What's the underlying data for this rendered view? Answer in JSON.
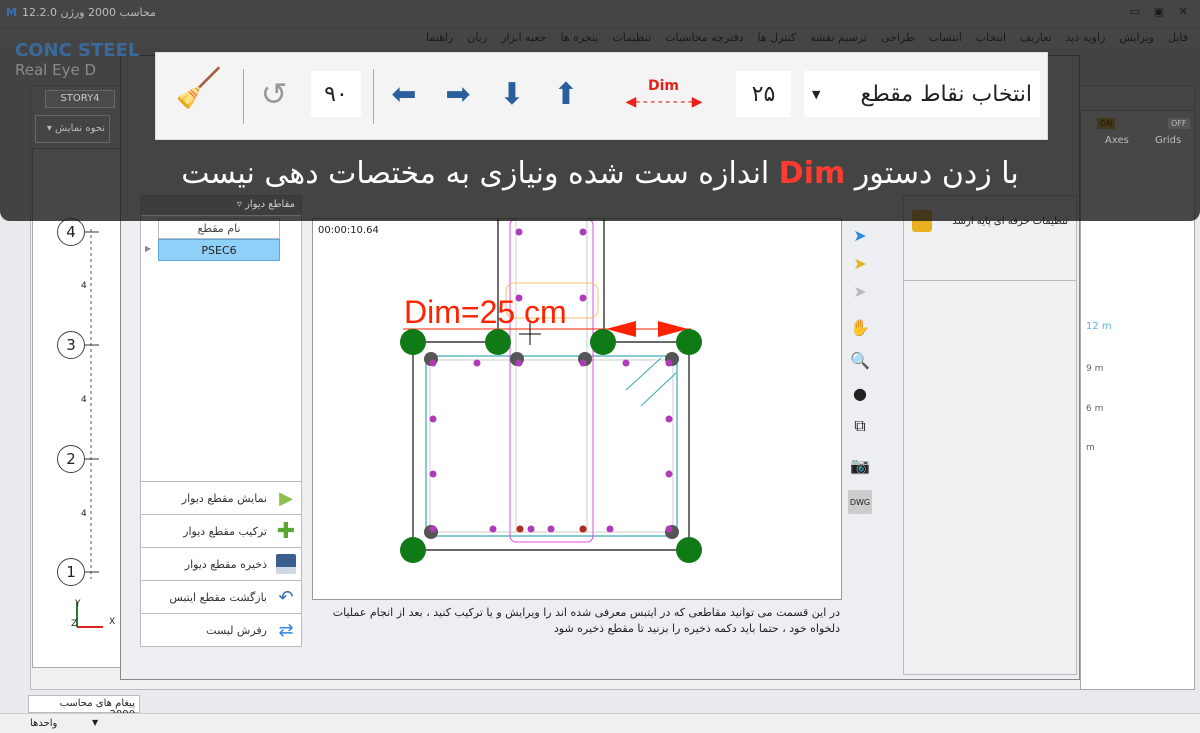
{
  "window": {
    "title": "محاسب 2000 ورژن 12.2.0",
    "app_icon": "M"
  },
  "menu": [
    "فایل",
    "ویرایش",
    "زاویه دید",
    "تعاریف",
    "انتخاب",
    "انتساب",
    "طراحی",
    "ترسیم نقشه",
    "کنترل ها",
    "دفترچه محاسبات",
    "تنظیمات",
    "پنجره ها",
    "جعبه ابزار",
    "زبان",
    "راهنما"
  ],
  "logo": {
    "text": "CONC STEEL",
    "subtitle": "Real Eye D"
  },
  "story_tab": "STORY4",
  "view_mode_dropdown": "نحوه نمایش",
  "plan_axes": [
    {
      "label": "4"
    },
    {
      "label": "3"
    },
    {
      "label": "2"
    },
    {
      "label": "1"
    }
  ],
  "plan_spacings": [
    "4",
    "4",
    "4"
  ],
  "axis_triad": {
    "x": "X",
    "y": "Y",
    "z": "Z"
  },
  "left_panel": {
    "title": "مقاطع دیوار",
    "column_header": "نام مقطع",
    "rows": [
      "PSEC6"
    ],
    "buttons": [
      {
        "label": "نمایش مقطع دیوار",
        "icon": "play-icon"
      },
      {
        "label": "ترکیب مقطع دیوار",
        "icon": "plus-icon"
      },
      {
        "label": "ذخیره مقطع دیوار",
        "icon": "save-icon"
      },
      {
        "label": "بازگشت مقطع ایتبس",
        "icon": "undo-icon"
      },
      {
        "label": "رفرش لیست",
        "icon": "refresh-icon"
      }
    ]
  },
  "canvas": {
    "timer": "00:00:10.64",
    "dim_label": "Dim=25 cm",
    "colors": {
      "support": "#0f7a16",
      "rebar": "#b03ab8",
      "dim": "#ff2200"
    }
  },
  "description": "در این قسمت می توانید مقاطعی که در ایتبس معرفی شده اند را ویرایش و یا ترکیب کنید ، بعد از انجام عملیات دلخواه خود ، حتما باید دکمه ذخیره را بزنید تا مقطع ذخیره شود",
  "right_panel": {
    "items": [
      "تنظیمات حرفه ای پایه ارشد"
    ]
  },
  "far_right": {
    "axes_label": "Axes",
    "grids_label": "Grids",
    "axes_toggle": "ON",
    "grids_toggle": "OFF",
    "labels": [
      "12 m",
      "9 m",
      "6 m",
      "m"
    ]
  },
  "messages_tab": "پیغام های محاسب 2000",
  "status": {
    "units": "واحدها"
  },
  "toolbar_popup": {
    "mode_select": "انتخاب نقاط مقطع",
    "dim_value": "۲۵",
    "dim_label": "Dim",
    "rotation_value": "۹۰"
  },
  "caption": {
    "before": "با زدن دستور",
    "keyword": "Dim",
    "after": "اندازه ست شده ونیازی به مختصات دهی نیست"
  }
}
